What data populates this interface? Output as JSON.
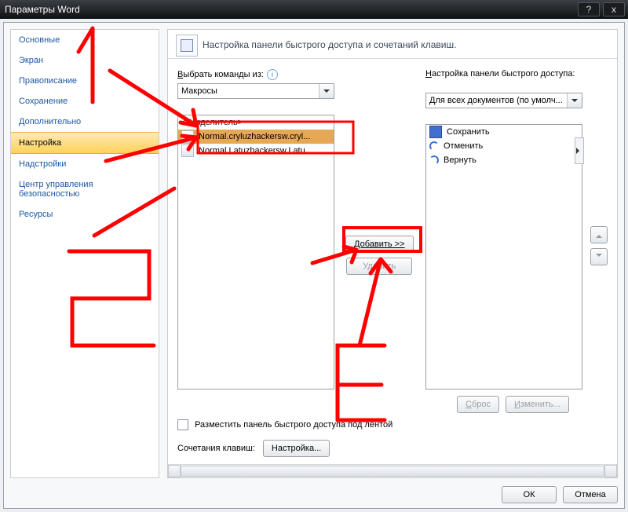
{
  "window": {
    "title": "Параметры Word"
  },
  "nav": {
    "items": [
      "Основные",
      "Экран",
      "Правописание",
      "Сохранение",
      "Дополнительно",
      "Настройка",
      "Надстройки",
      "Центр управления безопасностью",
      "Ресурсы"
    ],
    "selected_index": 5
  },
  "header": {
    "subtitle": "Настройка панели быстрого доступа и сочетаний клавиш."
  },
  "left_col": {
    "label_prefix": "В",
    "label_rest": "ыбрать команды из:",
    "dropdown_value": "Макросы",
    "list_header": "<Разделитель>",
    "items": [
      "Normal.cryluzhackersw.cryl...",
      "Normal.Latuzhackersw.Latu..."
    ]
  },
  "right_col": {
    "label_prefix": "Н",
    "label_rest": "астройка панели быстрого доступа:",
    "dropdown_value": "Для всех документов (по умолч...",
    "items": [
      "Сохранить",
      "Отменить",
      "Вернуть"
    ]
  },
  "mid_buttons": {
    "add": "Добавить >>",
    "remove": "Удалить"
  },
  "lower": {
    "reset_prefix": "С",
    "reset_rest": "брос",
    "modify_prefix": "И",
    "modify_rest": "зменить...",
    "checkbox_label": "Разместить панель быстрого доступа под лентой",
    "shortcuts_label": "Сочетания клавиш:",
    "shortcuts_button": "Настройка..."
  },
  "dialog_buttons": {
    "ok": "ОК",
    "cancel": "Отмена"
  },
  "anno_color": "#ff0000"
}
